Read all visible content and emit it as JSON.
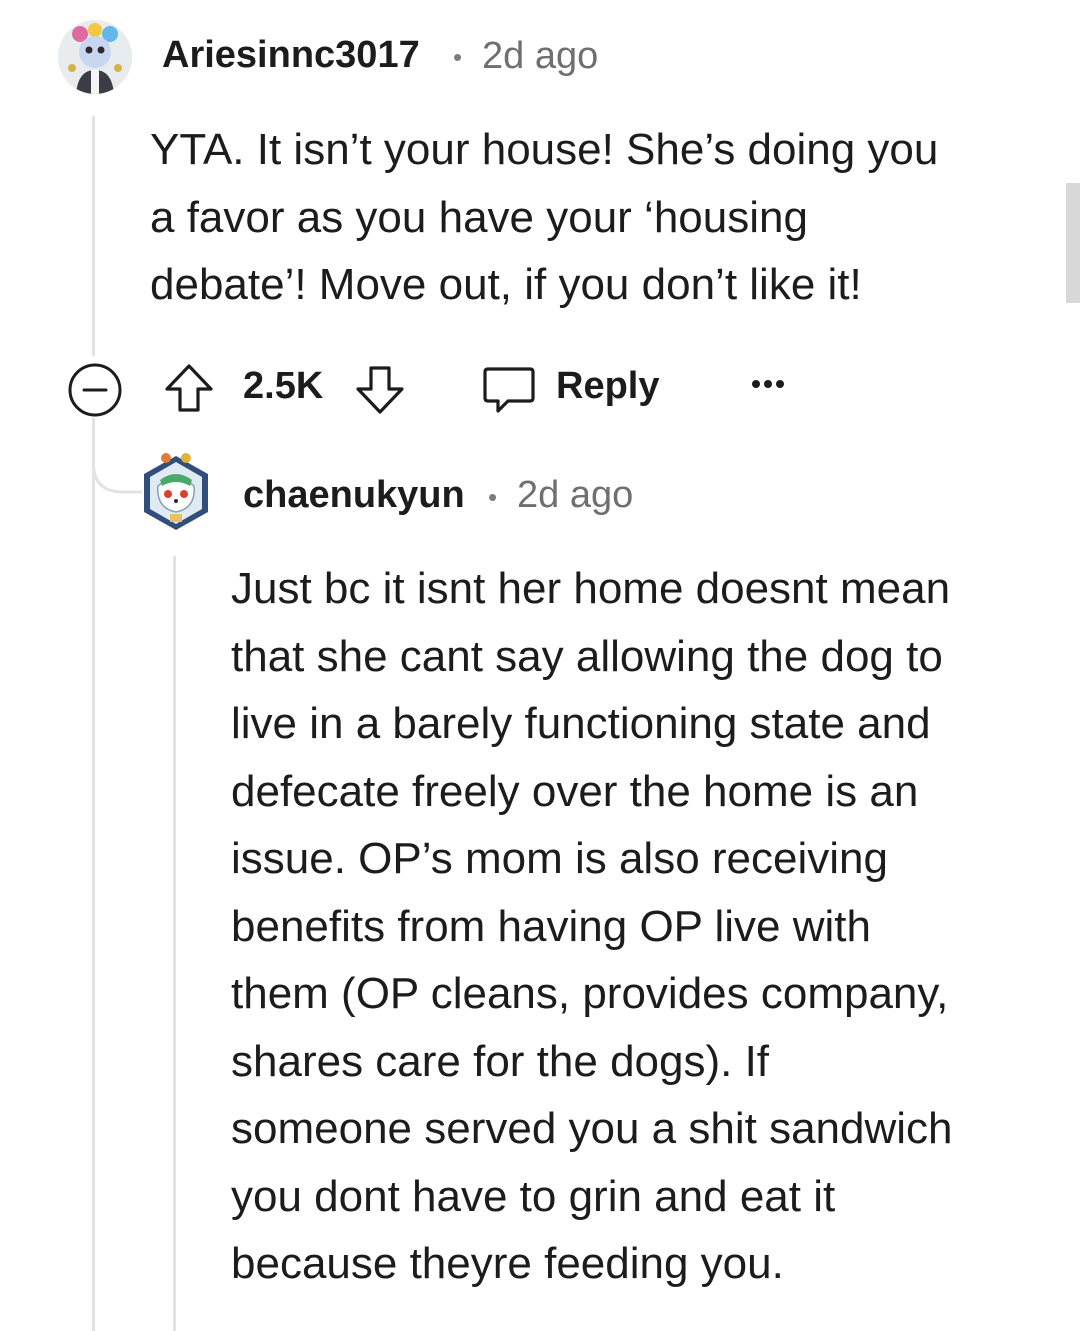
{
  "comment": {
    "username": "Ariesinnc3017",
    "separator": "•",
    "time": "2d ago",
    "body_lines": [
      "YTA. It isn’t your house! She’s doing you",
      "a favor as you have your ‘housing",
      "debate’! Move out, if you don’t like it!"
    ],
    "actions": {
      "score": "2.5K",
      "reply_label": "Reply",
      "more": "•••"
    }
  },
  "reply": {
    "username": "chaenukyun",
    "separator": "•",
    "time": "2d ago",
    "body_lines": [
      "Just bc it isnt her home doesnt mean",
      "that she cant say allowing the dog to",
      "live in a barely functioning state and",
      "defecate freely over the home is an",
      "issue. OP’s mom is also receiving",
      "benefits from having OP live with",
      "them (OP cleans, provides company,",
      "shares care for the dogs). If",
      "someone served you a shit sandwich",
      "you dont have to grin and eat it",
      "because theyre feeding you."
    ]
  },
  "icons": {
    "collapse": "collapse-icon",
    "upvote": "upvote-arrow-icon",
    "downvote": "downvote-arrow-icon",
    "reply": "speech-bubble-icon",
    "more": "more-options-icon"
  }
}
